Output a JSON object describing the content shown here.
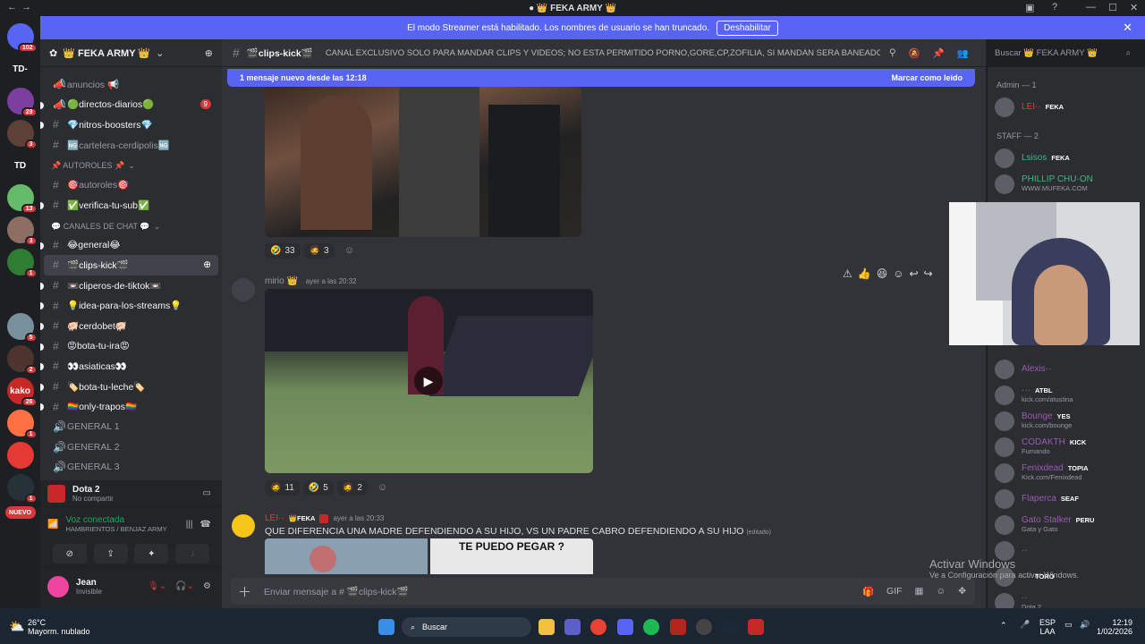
{
  "window": {
    "title": "FEKA ARMY"
  },
  "banner": {
    "text": "El modo Streamer está habilitado. Los nombres de usuario se han truncado.",
    "button": "Deshabilitar"
  },
  "servers": [
    {
      "label": "",
      "badge": "102",
      "color": "#5865f2"
    },
    {
      "label": "TD-",
      "badge": "",
      "color": "#1e1f22"
    },
    {
      "label": "",
      "badge": "29",
      "color": "#7b3fa0"
    },
    {
      "label": "",
      "badge": "3",
      "color": "#5d4037"
    },
    {
      "label": "TD",
      "badge": "",
      "color": "#1e1f22"
    },
    {
      "label": "",
      "badge": "13",
      "color": "#66bb6a"
    },
    {
      "label": "",
      "badge": "3",
      "color": "#8d6e63"
    },
    {
      "label": "",
      "badge": "1",
      "color": "#2e7d32"
    },
    {
      "label": "",
      "badge": "",
      "color": "#1e1f22"
    },
    {
      "label": "",
      "badge": "5",
      "color": "#78909c"
    },
    {
      "label": "",
      "badge": "2",
      "color": "#4e342e"
    },
    {
      "label": "kako",
      "badge": "26",
      "color": "#c62828"
    },
    {
      "label": "",
      "badge": "1",
      "color": "#ff7043"
    },
    {
      "label": "",
      "badge": "",
      "color": "#e53935"
    },
    {
      "label": "",
      "badge": "1",
      "color": "#263238"
    },
    {
      "label": "NUEVO",
      "badge": "",
      "color": "#da373c"
    }
  ],
  "guild": {
    "name": "👑 FEKA ARMY 👑"
  },
  "channels": [
    {
      "type": "cat",
      "label": "",
      "top": true
    },
    {
      "type": "ann",
      "label": "anuncios 📢",
      "white": false
    },
    {
      "type": "ann",
      "label": "🟢directos-diarios🟢",
      "white": true,
      "count": "9"
    },
    {
      "type": "text",
      "label": "💎nitros-boosters💎",
      "white": true
    },
    {
      "type": "text",
      "label": "🆖cartelera-cerdipolis🆖",
      "white": false
    },
    {
      "type": "cat",
      "label": "📌 AUTOROLES 📌"
    },
    {
      "type": "text",
      "label": "🎯autoroles🎯",
      "white": false
    },
    {
      "type": "text",
      "label": "✅verifica-tu-sub✅",
      "white": true
    },
    {
      "type": "cat",
      "label": "💬 CANALES DE CHAT 💬"
    },
    {
      "type": "text",
      "label": "😂general😂",
      "white": true
    },
    {
      "type": "text",
      "label": "🎬clips-kick🎬",
      "white": true,
      "active": true
    },
    {
      "type": "text",
      "label": "📼cliperos-de-tiktok📼",
      "white": true
    },
    {
      "type": "text",
      "label": "💡idea-para-los-streams💡",
      "white": true
    },
    {
      "type": "text",
      "label": "🐖cerdobet🐖",
      "white": true
    },
    {
      "type": "text",
      "label": "😡bota-tu-ira😡",
      "white": true
    },
    {
      "type": "text",
      "label": "👀asiaticas👀",
      "white": true
    },
    {
      "type": "text",
      "label": "🏷️bota-tu-leche🏷️",
      "white": true
    },
    {
      "type": "text",
      "label": "🏳️‍🌈only-trapos🏳️‍🌈",
      "white": true
    },
    {
      "type": "voice",
      "label": "GENERAL 1"
    },
    {
      "type": "voice",
      "label": "GENERAL 2"
    },
    {
      "type": "voice",
      "label": "GENERAL 3"
    }
  ],
  "voice_panel": {
    "game": "Dota 2",
    "game_sub": "No compartir",
    "status": "Voz conectada",
    "location": "HAMBRIENTOS / BENJAZ ARMY",
    "user": "Jean",
    "user_status": "Invisible"
  },
  "chat": {
    "channel": "🎬clips-kick🎬",
    "topic": "CANAL EXCLUSIVO SOLO PARA MANDAR CLIPS Y VIDEOS; NO ESTA PERMITIDO PORNO,GORE,CP,ZOFILIA, SI MANDAN SERA BANEADO PERMA...",
    "search_placeholder": "Buscar 👑 FEKA ARMY 👑",
    "new_messages": "1 mensaje nuevo desde las 12:18",
    "mark_read": "Marcar como leído",
    "reactions1": [
      {
        "emoji": "🤣",
        "count": "33"
      },
      {
        "emoji": "🧔",
        "count": "3"
      }
    ],
    "msg2_author": "mirio",
    "msg2_time": "ayer a las 20:32",
    "reactions2": [
      {
        "emoji": "🧔",
        "count": "11"
      },
      {
        "emoji": "🤣",
        "count": "5"
      },
      {
        "emoji": "🧔",
        "count": "2"
      }
    ],
    "msg3_author": "LEI··",
    "msg3_tag": "FEKA",
    "msg3_time": "ayer a las 20:33",
    "msg3_text": "QUE DIFERENCIA UNA MADRE DEFENDIENDO A SU HIJO, VS UN PADRE CABRO DEFENDIENDO A SU HIJO",
    "msg3_edited": "(editado)",
    "msg3_img_text": "TE PUEDO PEGAR ?",
    "input_placeholder": "Enviar mensaje a # 🎬clips-kick🎬"
  },
  "members": {
    "groups": [
      {
        "header": "Admin — 1",
        "rows": [
          {
            "name": "LEI··",
            "tag": "FEKA",
            "sub": "",
            "color": "#e53935"
          }
        ]
      },
      {
        "header": "STAFF — 2",
        "rows": [
          {
            "name": "Lsisos",
            "tag": "FEKA",
            "sub": "",
            "color": "#43b581"
          },
          {
            "name": "PHILLIP CHU·ON",
            "tag": "",
            "sub": "WWW.MUFEKA.COM",
            "color": "#43b581"
          }
        ]
      }
    ],
    "lower": [
      {
        "name": "Alexis··",
        "tag": "",
        "sub": "",
        "color": "#9b59b6"
      },
      {
        "name": "···",
        "tag": "ATBL",
        "sub": "kick.com/atustina",
        "color": "#9b59b6"
      },
      {
        "name": "Bounge",
        "tag": "YES",
        "sub": "kick.com/bounge",
        "color": "#9b59b6"
      },
      {
        "name": "CODAKTH",
        "tag": "KICK",
        "sub": "Fumando",
        "color": "#9b59b6"
      },
      {
        "name": "Fenixdead",
        "tag": "TOPIA",
        "sub": "Kick.com/Fenixdead",
        "color": "#9b59b6"
      },
      {
        "name": "Flaperca",
        "tag": "SEAF",
        "sub": "",
        "color": "#9b59b6"
      },
      {
        "name": "Gato Stalker",
        "tag": "PERU",
        "sub": "Gata y Gato",
        "color": "#9b59b6"
      },
      {
        "name": "··",
        "tag": "",
        "sub": "",
        "color": "#9b59b6"
      },
      {
        "name": "···",
        "tag": "TORO",
        "sub": "",
        "color": "#9b59b6"
      },
      {
        "name": "··",
        "tag": "",
        "sub": "Dota 2",
        "color": "#9b59b6"
      }
    ]
  },
  "watermark": {
    "title": "Activar Windows",
    "sub": "Ve a Configuración para activar Windows."
  },
  "taskbar": {
    "weather_temp": "26°C",
    "weather_desc": "Mayorm. nublado",
    "search": "Buscar",
    "lang": "ESP",
    "lang2": "LAA",
    "time": "12:19",
    "date": "1/02/2026"
  }
}
